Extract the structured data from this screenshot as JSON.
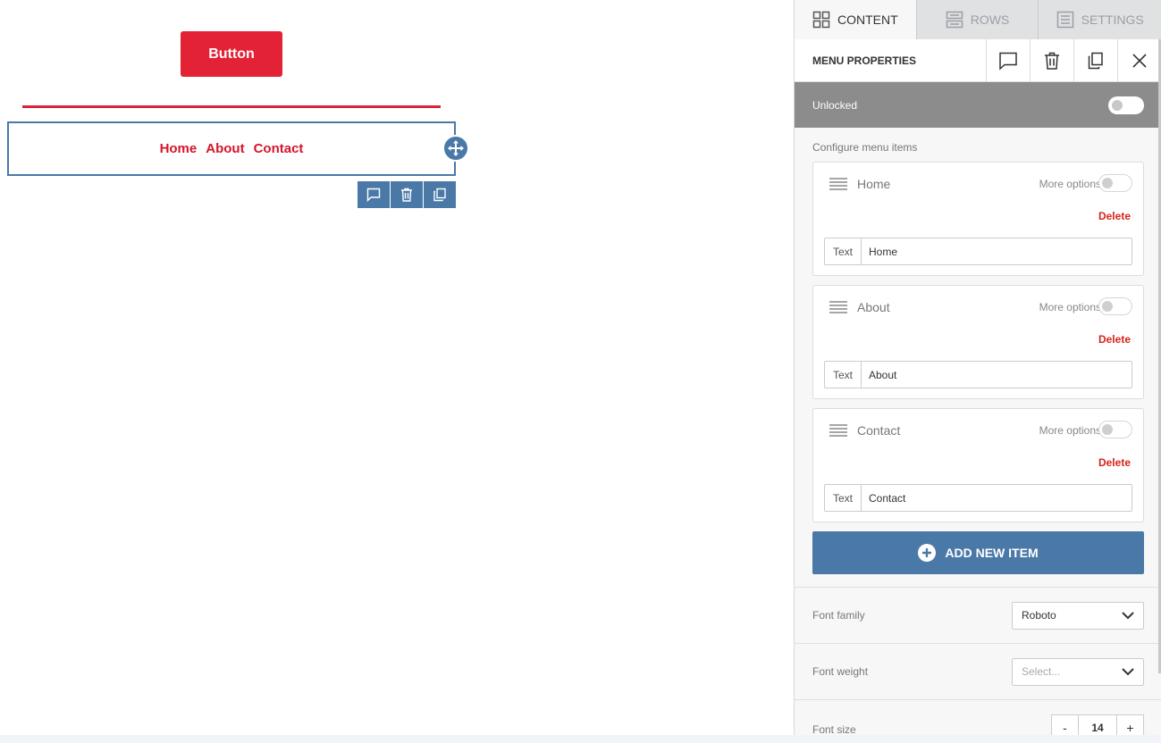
{
  "canvas": {
    "button_label": "Button",
    "menu_links": [
      "Home",
      "About",
      "Contact"
    ]
  },
  "colors": {
    "accent_red": "#e32236",
    "selection_blue": "#4a79a8",
    "delete_red": "#d5231b"
  },
  "tabs": [
    {
      "label": "CONTENT",
      "icon": "grid-icon",
      "active": true
    },
    {
      "label": "ROWS",
      "icon": "rows-icon",
      "active": false
    },
    {
      "label": "SETTINGS",
      "icon": "settings-doc-icon",
      "active": false
    }
  ],
  "properties": {
    "title": "MENU PROPERTIES",
    "lock_label": "Unlocked",
    "configure_label": "Configure menu items",
    "more_options_label": "More options",
    "delete_label": "Delete",
    "text_label": "Text",
    "items": [
      {
        "name": "Home",
        "text_value": "Home"
      },
      {
        "name": "About",
        "text_value": "About"
      },
      {
        "name": "Contact",
        "text_value": "Contact"
      }
    ],
    "add_button_label": "ADD NEW ITEM",
    "font_family_label": "Font family",
    "font_family_value": "Roboto",
    "font_weight_label": "Font weight",
    "font_weight_placeholder": "Select...",
    "font_size_label": "Font size",
    "font_size_value": "14",
    "minus": "-",
    "plus": "+"
  }
}
